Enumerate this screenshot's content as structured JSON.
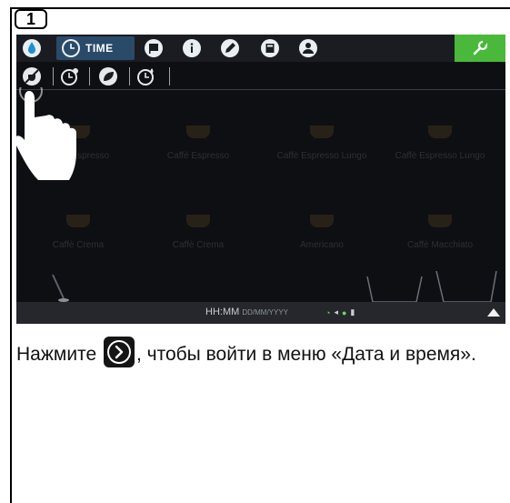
{
  "step": {
    "number": "1"
  },
  "topbar": {
    "time_label": "TIME",
    "icons": [
      "water-drop-icon",
      "clock-icon",
      "flag-icon",
      "info-icon",
      "pencil-icon",
      "calculator-icon",
      "user-icon",
      "wrench-icon"
    ],
    "wrench_color": "#49b83b"
  },
  "subbar": {
    "icons": [
      "cup-slash-icon",
      "clock-settings-icon",
      "leaf-icon",
      "timer-icon"
    ]
  },
  "products": {
    "row1": [
      "Caffè Espresso",
      "Caffè Espresso",
      "Caffè Espresso Lungo",
      "Caffè Espresso Lungo"
    ],
    "row2": [
      "Caffè Crema",
      "Caffè Crema",
      "Americano",
      "Caffè Macchiato"
    ]
  },
  "statusbar": {
    "time": "HH:MM",
    "date_format": "DD/MM/YYYY"
  },
  "instruction": {
    "before": "Нажмите",
    "after": ", чтобы войти в меню «Дата и время»."
  }
}
